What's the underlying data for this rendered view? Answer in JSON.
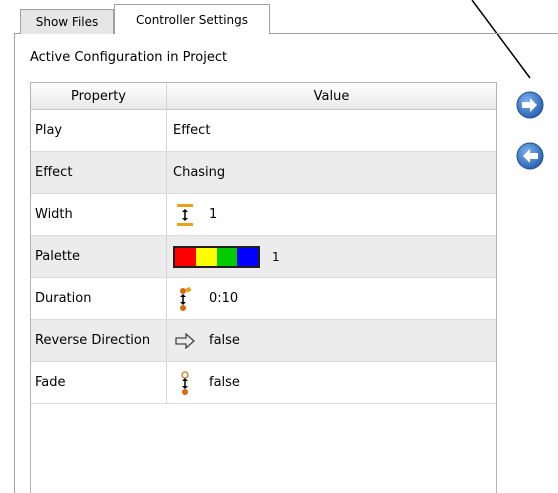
{
  "tabs": [
    {
      "label": "Show Files",
      "active": false
    },
    {
      "label": "Controller Settings",
      "active": true
    }
  ],
  "section_title": "Active Configuration in Project",
  "grid": {
    "headers": {
      "property": "Property",
      "value": "Value"
    },
    "rows": [
      {
        "property": "Play",
        "value": "Effect",
        "icon": null
      },
      {
        "property": "Effect",
        "value": "Chasing",
        "icon": null
      },
      {
        "property": "Width",
        "value": "1",
        "icon": "width-icon"
      },
      {
        "property": "Palette",
        "value": "1",
        "icon": "palette-swatch",
        "palette_colors": [
          "#ff0000",
          "#ffff00",
          "#00cc00",
          "#0000ff"
        ]
      },
      {
        "property": "Duration",
        "value": "0:10",
        "icon": "duration-icon"
      },
      {
        "property": "Reverse Direction",
        "value": "false",
        "icon": "arrow-right-outline-icon"
      },
      {
        "property": "Fade",
        "value": "false",
        "icon": "fade-icon"
      }
    ]
  },
  "side_buttons": {
    "right": {
      "icon": "arrow-right-circle-icon",
      "color": "#3a78c8"
    },
    "left": {
      "icon": "arrow-left-circle-icon",
      "color": "#3a78c8"
    }
  },
  "colors": {
    "accent": "#3a78c8",
    "border": "#a0a0a0",
    "alt_row": "#ececec"
  }
}
